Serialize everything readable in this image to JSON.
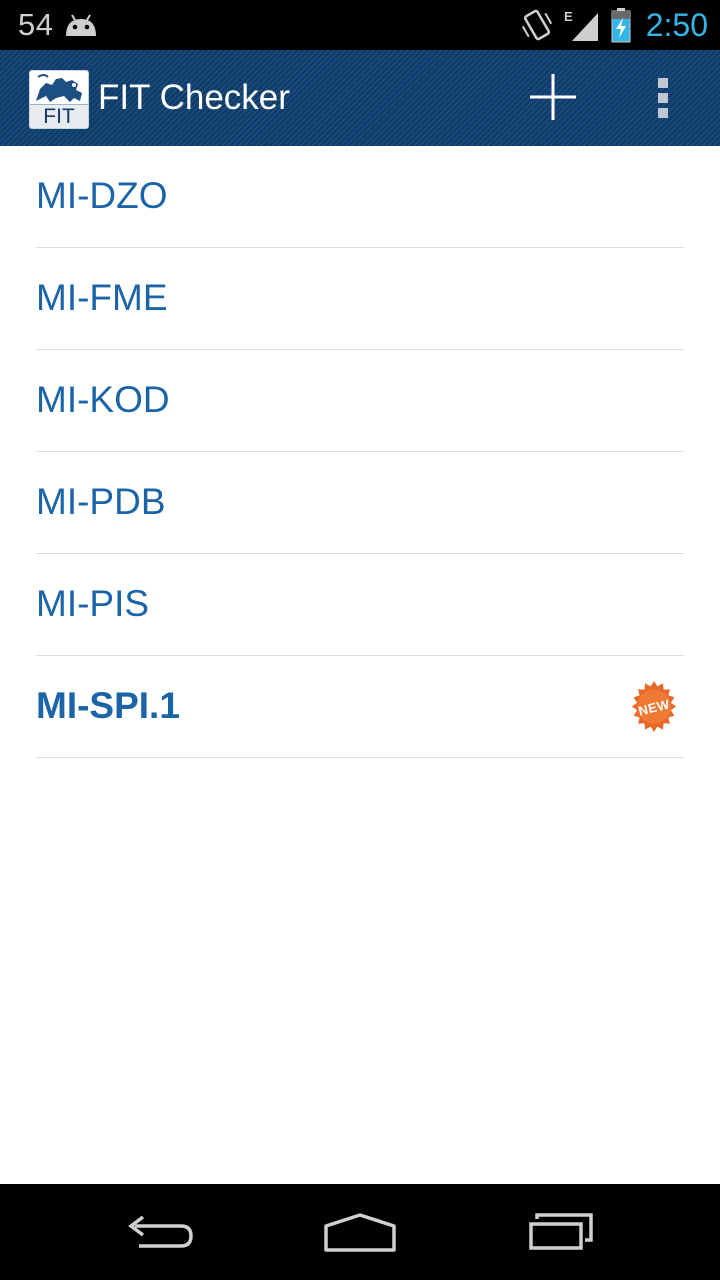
{
  "status_bar": {
    "notification_count": "54",
    "notification_icon": "android-debug-icon",
    "vibrate_icon": "vibrate-icon",
    "network_type": "E",
    "signal_icon": "signal-icon",
    "battery_icon": "battery-charging-icon",
    "time": "2:50",
    "clock_color": "#33b5e5"
  },
  "action_bar": {
    "logo_label": "FIT",
    "title": "FIT Checker",
    "add_icon": "plus-icon",
    "overflow_icon": "overflow-menu-icon",
    "background_color": "#0e3d6d"
  },
  "courses": [
    {
      "label": "MI-DZO",
      "is_new": false
    },
    {
      "label": "MI-FME",
      "is_new": false
    },
    {
      "label": "MI-KOD",
      "is_new": false
    },
    {
      "label": "MI-PDB",
      "is_new": false
    },
    {
      "label": "MI-PIS",
      "is_new": false
    },
    {
      "label": "MI-SPI.1",
      "is_new": true,
      "badge": "NEW"
    }
  ],
  "colors": {
    "list_text": "#1b64a8",
    "badge": "#e8682a",
    "divider": "#dcdcdc"
  },
  "nav_bar": {
    "back_icon": "back-icon",
    "home_icon": "home-icon",
    "recents_icon": "recent-apps-icon"
  }
}
